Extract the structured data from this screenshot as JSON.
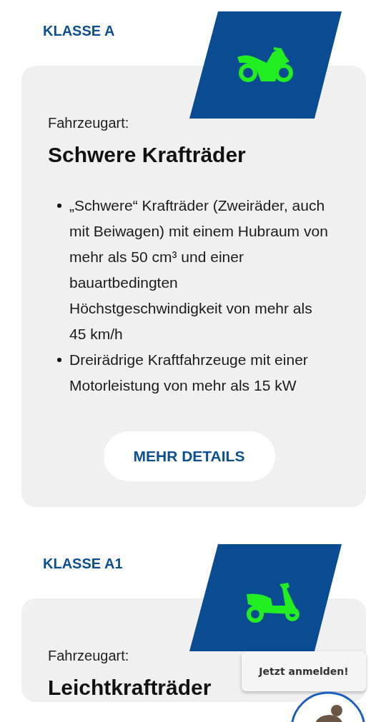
{
  "sections": [
    {
      "label": "KLASSE A",
      "kind": "motorcycle",
      "type_label": "Fahrzeugart:",
      "title": "Schwere Krafträder",
      "bullets": [
        "„Schwere“ Krafträder (Zweiräder, auch mit Beiwagen) mit einem Hubraum von mehr als 50 cm³ und einer bauartbedingten Höchstgeschwindigkeit von mehr als 45 km/h",
        "Dreirädrige Kraftfahrzeuge mit einer Motorleistung von mehr als 15 kW"
      ],
      "button": "MEHR DETAILS"
    },
    {
      "label": "KLASSE A1",
      "kind": "scooter",
      "type_label": "Fahrzeugart:",
      "title": "Leichtkrafträder"
    }
  ],
  "chat": {
    "prompt": "Jetzt anmelden!"
  }
}
